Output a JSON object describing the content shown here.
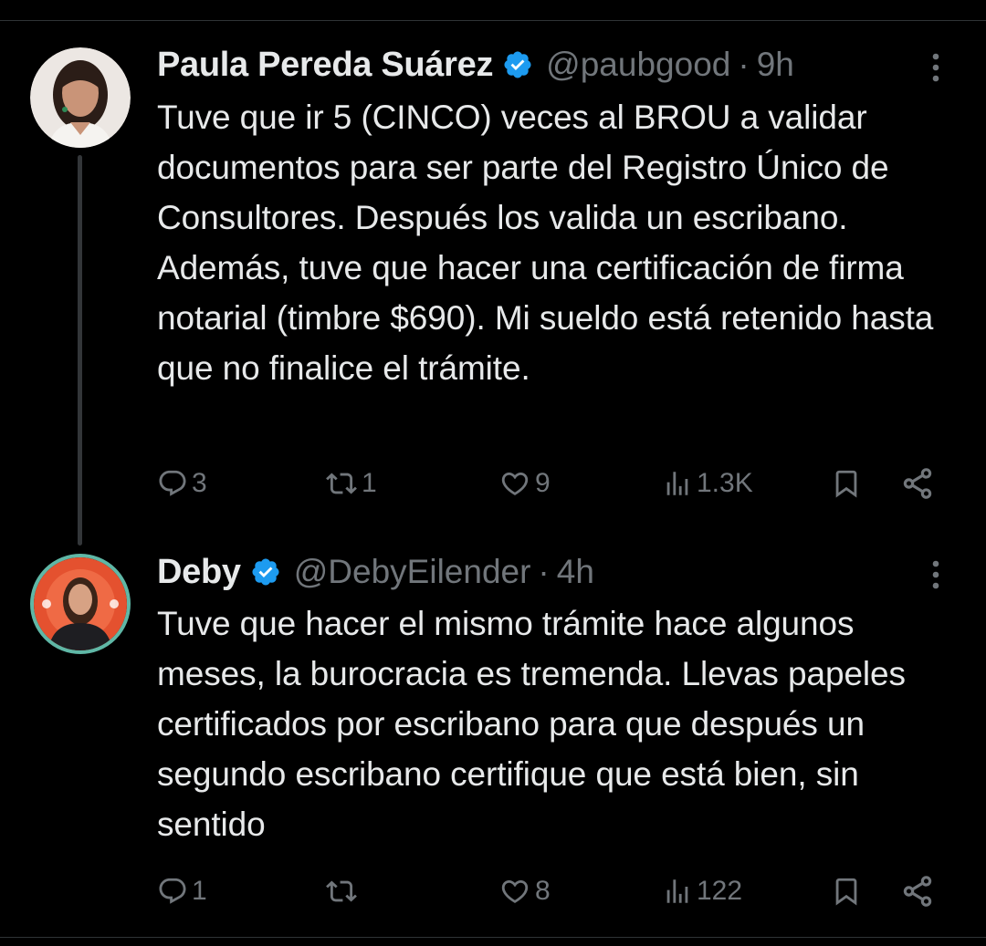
{
  "tweets": [
    {
      "display_name": "Paula Pereda Suárez",
      "handle": "@paubgood",
      "separator": "·",
      "time": "9h",
      "text": "Tuve que ir 5 (CINCO) veces al BROU a validar documentos para ser parte del Registro Único de Consultores. Después los valida un escribano. Además, tuve que hacer una certificación de firma notarial (timbre $690). Mi sueldo está retenido hasta que no finalice el trámite.",
      "replies": "3",
      "reposts": "1",
      "likes": "9",
      "views": "1.3K"
    },
    {
      "display_name": "Deby",
      "handle": "@DebyEilender",
      "separator": "·",
      "time": "4h",
      "text": "Tuve que hacer el mismo trámite hace algunos meses, la burocracia es tremenda. Llevas papeles certificados por escribano para que después un segundo escribano certifique que está bien, sin sentido",
      "replies": "1",
      "reposts": "",
      "likes": "8",
      "views": "122"
    }
  ],
  "icons": {
    "verified": "verified-badge-icon",
    "more": "more-options-icon",
    "reply": "reply-icon",
    "repost": "repost-icon",
    "like": "heart-icon",
    "views": "views-icon",
    "bookmark": "bookmark-icon",
    "share": "share-icon"
  },
  "colors": {
    "background": "#000000",
    "text_primary": "#e7e9ea",
    "text_secondary": "#71767b",
    "verified": "#1d9bf0",
    "thread_line": "#333639"
  }
}
